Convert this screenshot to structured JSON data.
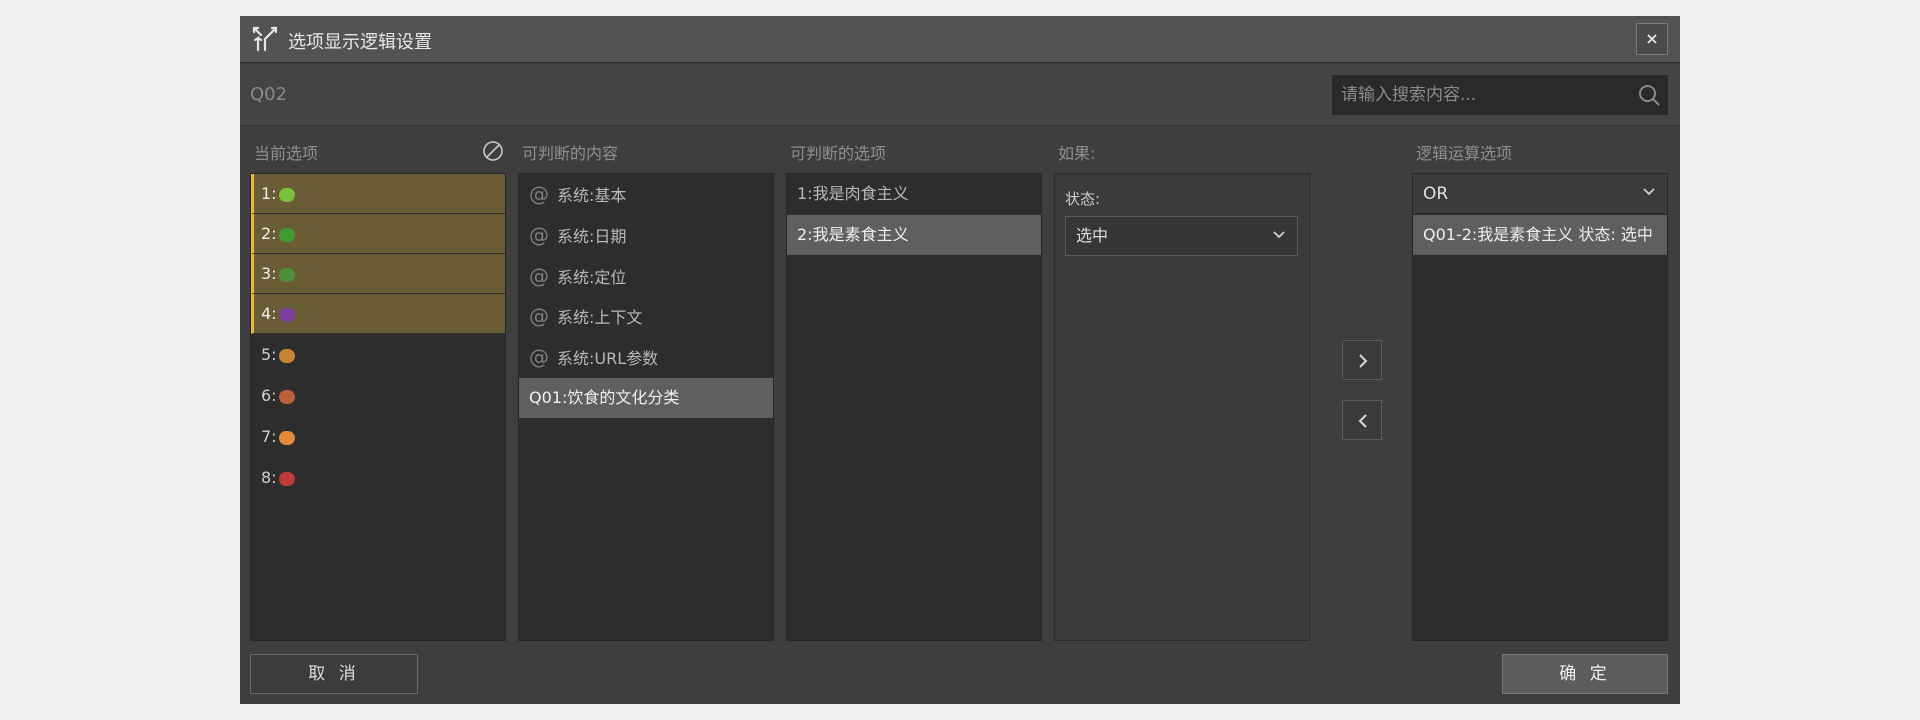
{
  "title": "选项显示逻辑设置",
  "close_label": "×",
  "question_id": "Q02",
  "search": {
    "placeholder": "请输入搜索内容..."
  },
  "columns": {
    "current_options": "当前选项",
    "judge_content": "可判断的内容",
    "judge_options": "可判断的选项",
    "if_label": "如果:",
    "logic_options": "逻辑运算选项"
  },
  "current_options": [
    {
      "label": "1:",
      "emoji_icon": "green-vegetable-icon",
      "color": "#7bbf3a",
      "selected": true
    },
    {
      "label": "2:",
      "emoji_icon": "cucumber-icon",
      "color": "#3f9a2f",
      "selected": true
    },
    {
      "label": "3:",
      "emoji_icon": "broccoli-icon",
      "color": "#4f8f3a",
      "selected": true
    },
    {
      "label": "4:",
      "emoji_icon": "eggplant-icon",
      "color": "#7a3fa0",
      "selected": true
    },
    {
      "label": "5:",
      "emoji_icon": "drumstick-icon",
      "color": "#c9843a",
      "selected": false
    },
    {
      "label": "6:",
      "emoji_icon": "meat-on-bone-icon",
      "color": "#b8603a",
      "selected": false
    },
    {
      "label": "7:",
      "emoji_icon": "shrimp-icon",
      "color": "#e08a3a",
      "selected": false
    },
    {
      "label": "8:",
      "emoji_icon": "steak-icon",
      "color": "#c03a3a",
      "selected": false
    }
  ],
  "judge_content": [
    {
      "label": "系统:基本",
      "at": "@"
    },
    {
      "label": "系统:日期",
      "at": "@"
    },
    {
      "label": "系统:定位",
      "at": "@"
    },
    {
      "label": "系统:上下文",
      "at": "@"
    },
    {
      "label": "系统:URL参数",
      "at": "@"
    },
    {
      "label": "Q01:饮食的文化分类",
      "at": ""
    }
  ],
  "judge_options": [
    {
      "label": "1:我是肉食主义"
    },
    {
      "label": "2:我是素食主义"
    }
  ],
  "if_panel": {
    "state_label": "状态:",
    "state_value": "选中"
  },
  "logic": {
    "operator": "OR",
    "rule": "Q01-2:我是素食主义 状态: 选中"
  },
  "buttons": {
    "cancel": "取 消",
    "confirm": "确 定"
  },
  "colors": {
    "selected_bg": "#6a5c34",
    "selected_accent": "#e2b93b"
  }
}
